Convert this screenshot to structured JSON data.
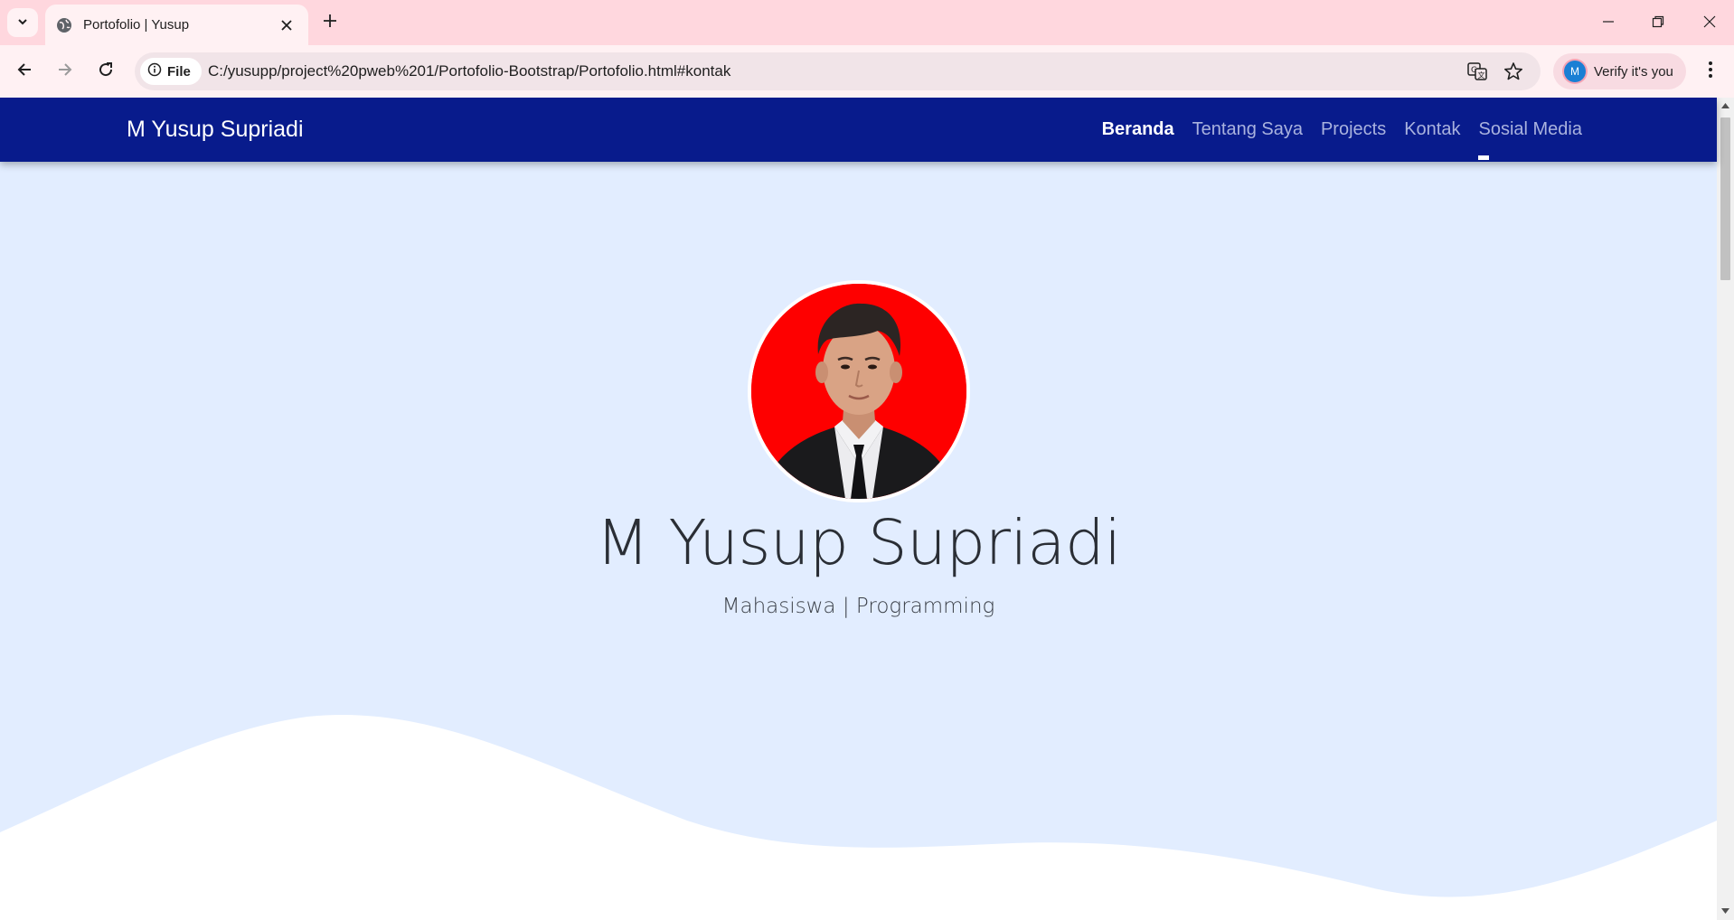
{
  "browser": {
    "tab": {
      "title": "Portofolio | Yusup"
    },
    "omnibox": {
      "chip_label": "File",
      "url": "C:/yusupp/project%20pweb%201/Portofolio-Bootstrap/Portofolio.html#kontak"
    },
    "profile": {
      "initial": "M",
      "label": "Verify it's you"
    }
  },
  "site": {
    "brand": "M Yusup Supriadi",
    "nav": [
      {
        "label": "Beranda",
        "active": true
      },
      {
        "label": "Tentang Saya",
        "active": false
      },
      {
        "label": "Projects",
        "active": false
      },
      {
        "label": "Kontak",
        "active": false
      },
      {
        "label": "Sosial Media",
        "active": false
      }
    ],
    "hero": {
      "name": "M Yusup Supriadi",
      "subtitle": "Mahasiswa | Programming"
    }
  },
  "colors": {
    "tabbar": "#ffd7de",
    "navbar": "#081b8c",
    "hero_bg": "#e2edff",
    "photo_bg": "#fe0000"
  }
}
